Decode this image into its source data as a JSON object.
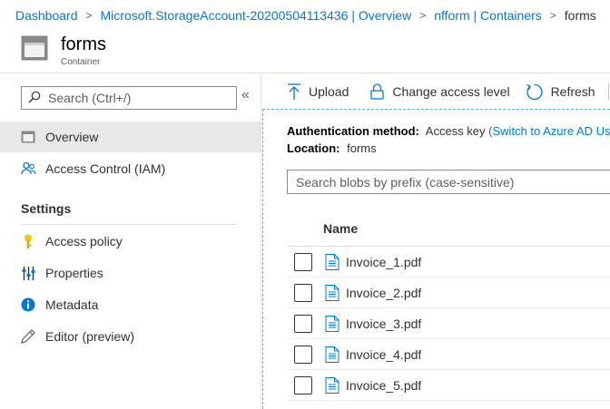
{
  "breadcrumb": {
    "items": [
      "Dashboard",
      "Microsoft.StorageAccount-20200504113436 | Overview",
      "nfform | Containers"
    ],
    "current": "forms"
  },
  "header": {
    "title": "forms",
    "subtitle": "Container",
    "icon": "container-icon"
  },
  "sidebar": {
    "search_placeholder": "Search (Ctrl+/)",
    "collapse_glyph": "«",
    "items": [
      {
        "label": "Overview",
        "icon": "overview-icon",
        "active": true
      },
      {
        "label": "Access Control (IAM)",
        "icon": "people-icon"
      }
    ],
    "settings_label": "Settings",
    "settings_items": [
      {
        "label": "Access policy",
        "icon": "key-icon"
      },
      {
        "label": "Properties",
        "icon": "properties-icon"
      },
      {
        "label": "Metadata",
        "icon": "info-icon"
      },
      {
        "label": "Editor (preview)",
        "icon": "pencil-icon"
      }
    ]
  },
  "toolbar": {
    "upload_label": "Upload",
    "change_access_label": "Change access level",
    "refresh_label": "Refresh"
  },
  "content": {
    "auth_label": "Authentication method:",
    "auth_value": "Access key",
    "auth_link": "(Switch to Azure AD User Account)",
    "location_label": "Location:",
    "location_value": "forms",
    "blob_search_placeholder": "Search blobs by prefix (case-sensitive)",
    "column_name": "Name",
    "files": [
      "Invoice_1.pdf",
      "Invoice_2.pdf",
      "Invoice_3.pdf",
      "Invoice_4.pdf",
      "Invoice_5.pdf"
    ]
  },
  "colors": {
    "accent": "#0078d4",
    "active_bg": "#e8e8e8",
    "key": "#f2c811",
    "info": "#0078d4"
  }
}
